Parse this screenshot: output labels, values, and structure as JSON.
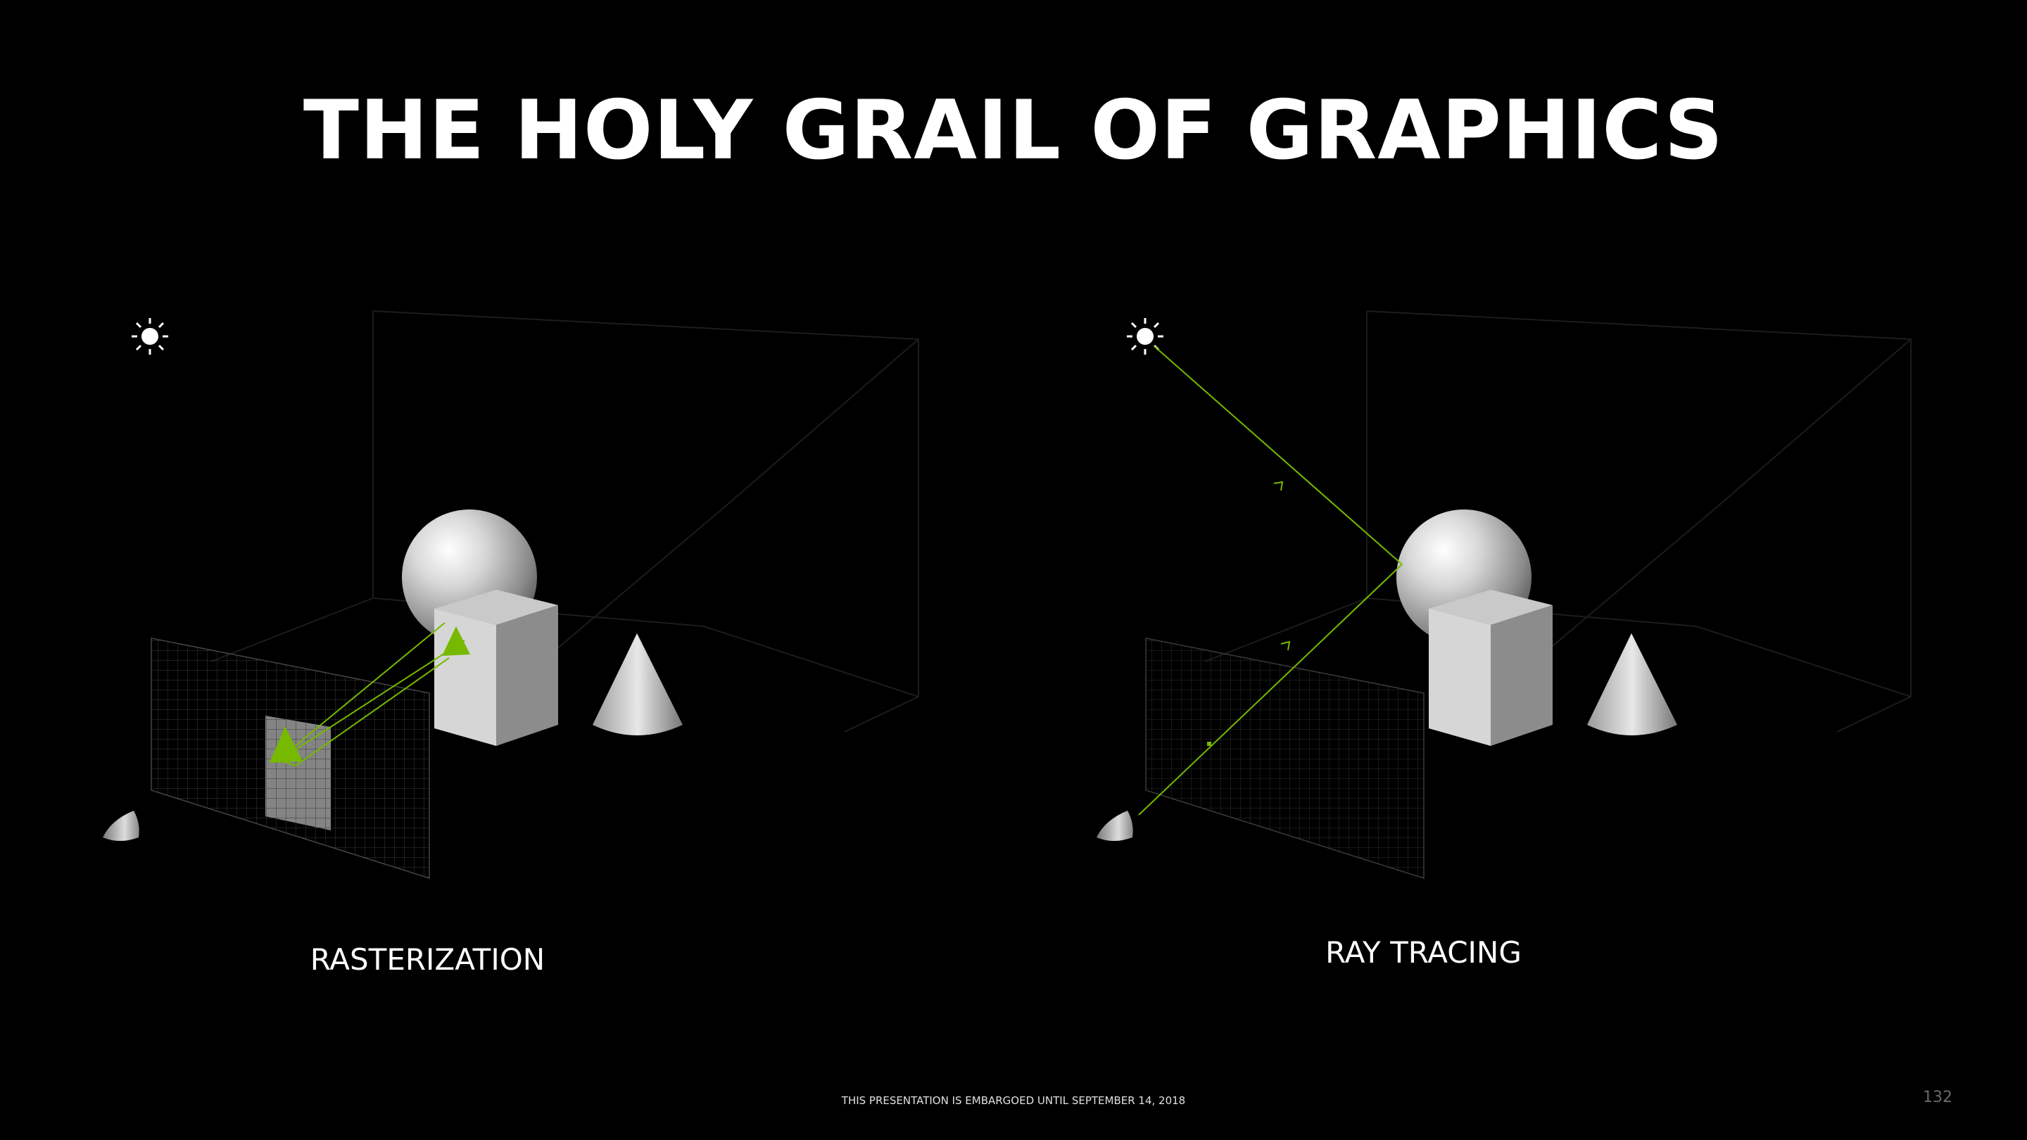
{
  "slide": {
    "title": "THE HOLY GRAIL OF GRAPHICS",
    "footer": "THIS PRESENTATION IS EMBARGOED UNTIL SEPTEMBER 14, 2018",
    "page_number": "132"
  },
  "panels": [
    {
      "caption": "RASTERIZATION"
    },
    {
      "caption": "RAY TRACING"
    }
  ],
  "colors": {
    "background": "#000000",
    "accent_green": "#76b900",
    "text": "#ffffff"
  },
  "icons": [
    "light-source-icon",
    "camera-icon"
  ]
}
